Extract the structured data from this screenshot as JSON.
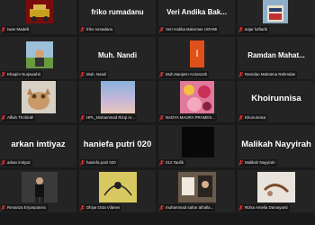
{
  "colors": {
    "background": "#1a1a1a",
    "tile": "#242424",
    "name_text": "#ffffff",
    "label_text": "#e8e8e8",
    "muted_mic": "#d93030",
    "avatar_orange": "#e0501a"
  },
  "participants": [
    {
      "label": "Iwan Madelli",
      "display_name": ""
    },
    {
      "label": "friko rumadanu",
      "display_name": "friko rumadanu"
    },
    {
      "label": "Veri Andika Bakomas UGHMI",
      "display_name": "Veri Andika Bak..."
    },
    {
      "label": "anjar lutfiarbi",
      "display_name": ""
    },
    {
      "label": "Khaqim Nurjawahir",
      "display_name": ""
    },
    {
      "label": "Muh. Nandi",
      "display_name": "Muh. Nandi"
    },
    {
      "label": "Muh.Nanjwm Azrianzah",
      "display_name": "",
      "avatar_letter": "I"
    },
    {
      "label": "Ramdan Mahatma Rahmdan",
      "display_name": "Ramdan Mahat..."
    },
    {
      "label": "Alfiah Thohirah",
      "display_name": ""
    },
    {
      "label": "HPL_Muhammad Rizqi Ar...",
      "display_name": ""
    },
    {
      "label": "NADYA MAURA PRAMES...",
      "display_name": ""
    },
    {
      "label": "Khoirunnisa",
      "display_name": "Khoirunnisa"
    },
    {
      "label": "arkan imtiyaz",
      "display_name": "arkan imtiyaz"
    },
    {
      "label": "haniefa putri 020",
      "display_name": "haniefa putri 020"
    },
    {
      "label": "012 Taufik",
      "display_name": ""
    },
    {
      "label": "Malikah Nayyirah",
      "display_name": "Malikah Nayyirah"
    },
    {
      "label": "Renanza Eryanputera",
      "display_name": ""
    },
    {
      "label": "Dhiya Octa Vilanes",
      "display_name": ""
    },
    {
      "label": "muhammad sahar athalla...",
      "display_name": ""
    },
    {
      "label": "Rizka Amelia Damayanti",
      "display_name": ""
    }
  ]
}
